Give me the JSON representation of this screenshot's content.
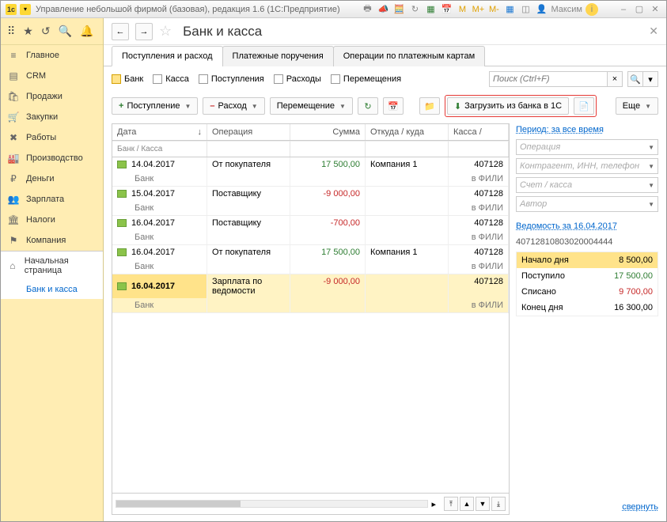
{
  "titlebar": {
    "title": "Управление небольшой фирмой (базовая), редакция 1.6  (1С:Предприятие)",
    "user": "Максим"
  },
  "sidebar": {
    "items": [
      {
        "icon": "≡",
        "label": "Главное"
      },
      {
        "icon": "▤",
        "label": "CRM"
      },
      {
        "icon": "🛍",
        "label": "Продажи"
      },
      {
        "icon": "🛒",
        "label": "Закупки"
      },
      {
        "icon": "✖",
        "label": "Работы"
      },
      {
        "icon": "🏭",
        "label": "Производство"
      },
      {
        "icon": "₽",
        "label": "Деньги"
      },
      {
        "icon": "👥",
        "label": "Зарплата"
      },
      {
        "icon": "🏛",
        "label": "Налоги"
      },
      {
        "icon": "⚑",
        "label": "Компания"
      }
    ],
    "sub": [
      {
        "icon": "⌂",
        "label": "Начальная страница"
      },
      {
        "icon": "",
        "label": "Банк и касса"
      }
    ]
  },
  "page": {
    "title": "Банк и касса",
    "tabs": [
      "Поступления и расход",
      "Платежные поручения",
      "Операции по платежным картам"
    ],
    "filters": [
      "Банк",
      "Касса",
      "Поступления",
      "Расходы",
      "Перемещения"
    ],
    "search_ph": "Поиск (Ctrl+F)",
    "toolbar": {
      "add": "Поступление",
      "minus": "Расход",
      "move": "Перемещение",
      "load": "Загрузить из банка в 1С",
      "more": "Еще"
    },
    "columns": {
      "date": "Дата",
      "bank": "Банк / Касса",
      "op": "Операция",
      "sum": "Сумма",
      "where": "Откуда / куда",
      "kassa": "Касса /"
    },
    "rows": [
      {
        "date": "14.04.2017",
        "bank": "Банк",
        "op": "От покупателя",
        "sum": "17 500,00",
        "neg": false,
        "where": "Компания 1",
        "k1": "407128",
        "k2": "в ФИЛИ"
      },
      {
        "date": "15.04.2017",
        "bank": "Банк",
        "op": "Поставщику",
        "sum": "-9 000,00",
        "neg": true,
        "where": "",
        "k1": "407128",
        "k2": "в ФИЛИ"
      },
      {
        "date": "16.04.2017",
        "bank": "Банк",
        "op": "Поставщику",
        "sum": "-700,00",
        "neg": true,
        "where": "",
        "k1": "407128",
        "k2": "в ФИЛИ"
      },
      {
        "date": "16.04.2017",
        "bank": "Банк",
        "op": "От покупателя",
        "sum": "17 500,00",
        "neg": false,
        "where": "Компания 1",
        "k1": "407128",
        "k2": "в ФИЛИ"
      },
      {
        "date": "16.04.2017",
        "bank": "Банк",
        "op": "Зарплата по ведомости",
        "sum": "-9 000,00",
        "neg": true,
        "where": "",
        "k1": "407128",
        "k2": "в ФИЛИ",
        "sel": true
      }
    ]
  },
  "right": {
    "period": "Период: за все время",
    "op_ph": "Операция",
    "contr_ph": "Контрагент, ИНН, телефон",
    "acc_ph": "Счет / касса",
    "auth_ph": "Автор",
    "vedomost": "Ведомость за 16.04.2017",
    "account": "40712810803020004444",
    "summary": [
      {
        "label": "Начало дня",
        "value": "8 500,00",
        "cls": "hl"
      },
      {
        "label": "Поступило",
        "value": "17 500,00",
        "cls": "pos"
      },
      {
        "label": "Списано",
        "value": "9 700,00",
        "cls": "neg"
      },
      {
        "label": "Конец дня",
        "value": "16 300,00",
        "cls": ""
      }
    ],
    "collapse": "свернуть"
  }
}
